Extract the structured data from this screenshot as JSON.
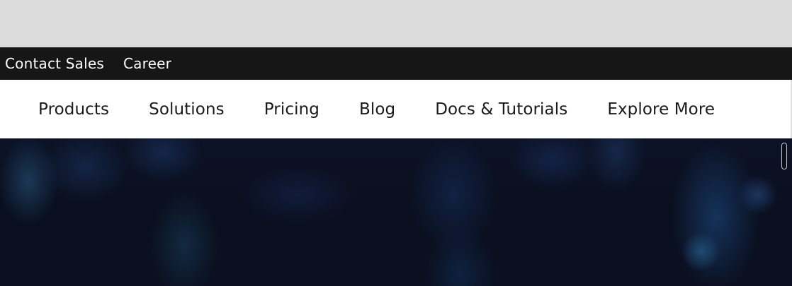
{
  "utility_bar": {
    "links": [
      {
        "label": "Contact Sales"
      },
      {
        "label": "Career"
      }
    ]
  },
  "main_nav": {
    "items": [
      {
        "label": "Products"
      },
      {
        "label": "Solutions"
      },
      {
        "label": "Pricing"
      },
      {
        "label": "Blog"
      },
      {
        "label": "Docs & Tutorials"
      },
      {
        "label": "Explore More"
      }
    ]
  },
  "colors": {
    "top_background": "#dbdbdb",
    "utility_bar_background": "#161616",
    "nav_background": "#ffffff",
    "hero_background": "#0a0f1f"
  }
}
